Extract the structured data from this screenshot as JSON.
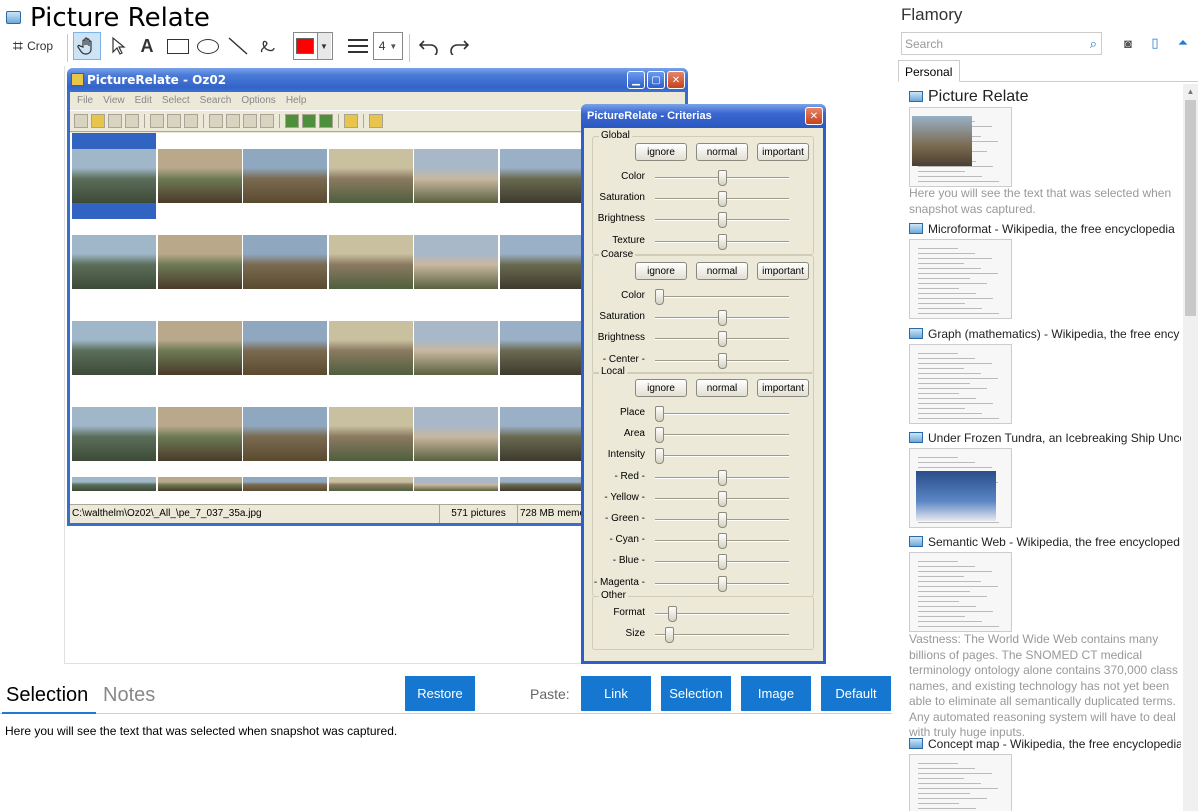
{
  "app": {
    "title": "Picture Relate"
  },
  "toolbar": {
    "crop_label": "Crop",
    "line_width": "4",
    "colors": {
      "stroke": "#ff0000"
    }
  },
  "picture_relate": {
    "window_title": "PictureRelate - Oz02",
    "menu": [
      "File",
      "View",
      "Edit",
      "Select",
      "Search",
      "Options",
      "Help"
    ],
    "status": {
      "path": "C:\\walthelm\\Oz02\\_All_\\pe_7_037_35a.jpg",
      "count": "571 pictures",
      "memory": "728 MB memor"
    }
  },
  "criterias": {
    "title": "PictureRelate - Criterias",
    "buttons": {
      "ignore": "ignore",
      "normal": "normal",
      "important": "important"
    },
    "groups": [
      {
        "name": "Global",
        "sliders": [
          {
            "label": "Color",
            "level": 0.5
          },
          {
            "label": "Saturation",
            "level": 0.5
          },
          {
            "label": "Brightness",
            "level": 0.5
          },
          {
            "label": "Texture",
            "level": 0.5
          }
        ]
      },
      {
        "name": "Coarse",
        "sliders": [
          {
            "label": "Color",
            "level": 0.0
          },
          {
            "label": "Saturation",
            "level": 0.5
          },
          {
            "label": "Brightness",
            "level": 0.5
          },
          {
            "label": "- Center -",
            "level": 0.5
          }
        ]
      },
      {
        "name": "Local",
        "sliders": [
          {
            "label": "Place",
            "level": 0.0
          },
          {
            "label": "Area",
            "level": 0.0
          },
          {
            "label": "Intensity",
            "level": 0.0
          },
          {
            "label": "- Red -",
            "level": 0.5
          },
          {
            "label": "- Yellow -",
            "level": 0.5
          },
          {
            "label": "- Green -",
            "level": 0.5
          },
          {
            "label": "- Cyan -",
            "level": 0.5
          },
          {
            "label": "- Blue -",
            "level": 0.5
          },
          {
            "label": "- Magenta -",
            "level": 0.5
          }
        ]
      },
      {
        "name": "Other",
        "sliders": [
          {
            "label": "Format",
            "level": 0.1
          },
          {
            "label": "Size",
            "level": 0.08
          }
        ]
      }
    ]
  },
  "bottom": {
    "tab_selection": "Selection",
    "tab_notes": "Notes",
    "restore": "Restore",
    "paste_label": "Paste:",
    "link": "Link",
    "selection": "Selection",
    "image": "Image",
    "default": "Default",
    "selection_text": "Here you will see the text that was selected when snapshot was captured.",
    "accent": "#1577d0"
  },
  "sidebar": {
    "title": "Flamory",
    "search_placeholder": "Search",
    "tab_personal": "Personal",
    "items": [
      {
        "title": "Picture Relate",
        "desc": "Here you will see the text that was selected when snapshot was captured."
      },
      {
        "title": "Microformat - Wikipedia, the free encyclopedia",
        "desc": ""
      },
      {
        "title": "Graph (mathematics) - Wikipedia, the free ency",
        "desc": ""
      },
      {
        "title": "Under Frozen Tundra, an Icebreaking Ship Unco",
        "desc": ""
      },
      {
        "title": "Semantic Web - Wikipedia, the free encycloped",
        "desc": "Vastness: The World Wide Web contains many billions of pages. The SNOMED CT medical terminology ontology alone contains 370,000 class names, and existing technology has not yet been able to eliminate all semantically duplicated terms. Any automated reasoning system will have to deal with truly huge inputs."
      },
      {
        "title": "Concept map - Wikipedia, the free encyclopedia",
        "desc": ""
      }
    ]
  }
}
